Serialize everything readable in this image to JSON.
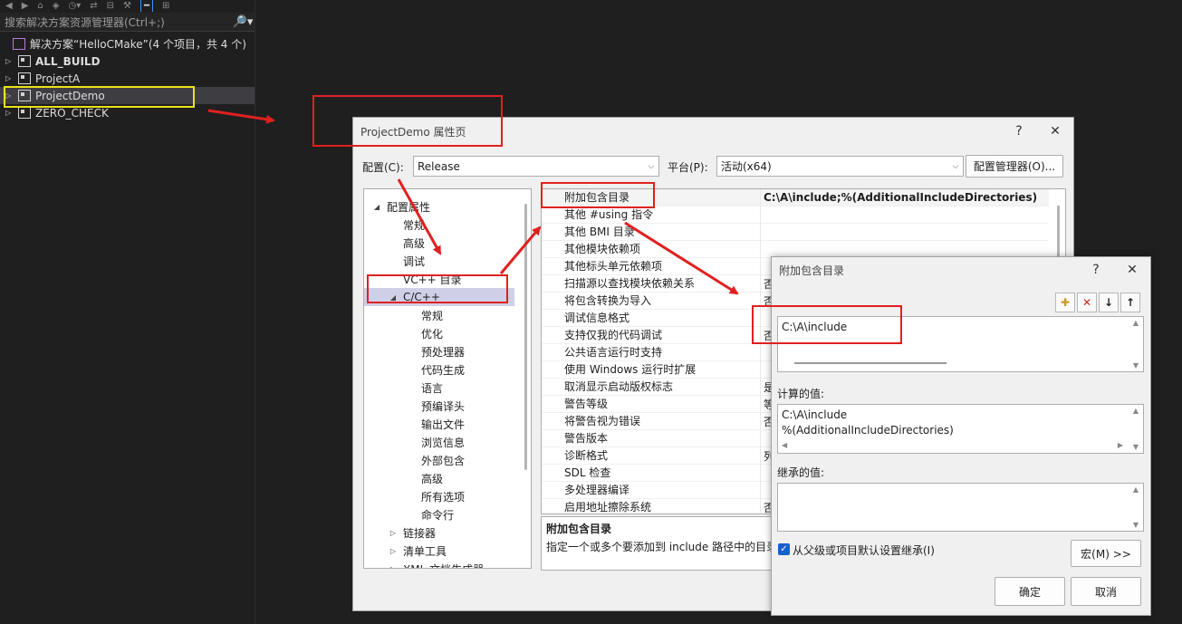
{
  "explorer": {
    "toolbar_icons": [
      "back-icon",
      "forward-icon",
      "home-icon",
      "vs-icon",
      "history-icon",
      "sync-icon",
      "collapse-icon",
      "wrench-icon",
      "active-view-icon",
      "graph-icon"
    ],
    "search_placeholder": "搜索解决方案资源管理器(Ctrl+;)",
    "search_icon": "🔎▾",
    "solution_label": "解决方案“HelloCMake”(4 个项目，共 4 个)",
    "projects": [
      {
        "name": "ALL_BUILD",
        "bold": true
      },
      {
        "name": "ProjectA",
        "bold": false
      },
      {
        "name": "ProjectDemo",
        "bold": false,
        "selected": true
      },
      {
        "name": "ZERO_CHECK",
        "bold": false
      }
    ]
  },
  "property_dialog": {
    "title": "ProjectDemo 属性页",
    "help": "?",
    "close": "✕",
    "config_label": "配置(C):",
    "config_value": "Release",
    "platform_label": "平台(P):",
    "platform_value": "活动(x64)",
    "config_manager": "配置管理器(O)...",
    "nav": [
      {
        "label": "配置属性",
        "level": 0,
        "tri": "◢"
      },
      {
        "label": "常规",
        "level": 1
      },
      {
        "label": "高级",
        "level": 1
      },
      {
        "label": "调试",
        "level": 1
      },
      {
        "label": "VC++ 目录",
        "level": 1
      },
      {
        "label": "C/C++",
        "level": 1,
        "tri": "◢",
        "selected": true
      },
      {
        "label": "常规",
        "level": 2
      },
      {
        "label": "优化",
        "level": 2
      },
      {
        "label": "预处理器",
        "level": 2
      },
      {
        "label": "代码生成",
        "level": 2
      },
      {
        "label": "语言",
        "level": 2
      },
      {
        "label": "预编译头",
        "level": 2
      },
      {
        "label": "输出文件",
        "level": 2
      },
      {
        "label": "浏览信息",
        "level": 2
      },
      {
        "label": "外部包含",
        "level": 2
      },
      {
        "label": "高级",
        "level": 2
      },
      {
        "label": "所有选项",
        "level": 2
      },
      {
        "label": "命令行",
        "level": 2
      },
      {
        "label": "链接器",
        "level": 1,
        "tri": "▷"
      },
      {
        "label": "清单工具",
        "level": 1,
        "tri": "▷"
      },
      {
        "label": "XML 文档生成器",
        "level": 1,
        "tri": "▷"
      }
    ],
    "grid": [
      {
        "name": "附加包含目录",
        "value": "C:\\A\\include;%(AdditionalIncludeDirectories)"
      },
      {
        "name": "其他 #using 指令",
        "value": ""
      },
      {
        "name": "其他 BMI 目录",
        "value": ""
      },
      {
        "name": "其他模块依赖项",
        "value": ""
      },
      {
        "name": "其他标头单元依赖项",
        "value": ""
      },
      {
        "name": "扫描源以查找模块依赖关系",
        "value": "否"
      },
      {
        "name": "将包含转换为导入",
        "value": "否"
      },
      {
        "name": "调试信息格式",
        "value": ""
      },
      {
        "name": "支持仅我的代码调试",
        "value": "否"
      },
      {
        "name": "公共语言运行时支持",
        "value": ""
      },
      {
        "name": "使用 Windows 运行时扩展",
        "value": ""
      },
      {
        "name": "取消显示启动版权标志",
        "value": "是"
      },
      {
        "name": "警告等级",
        "value": "等"
      },
      {
        "name": "将警告视为错误",
        "value": "否"
      },
      {
        "name": "警告版本",
        "value": ""
      },
      {
        "name": "诊断格式",
        "value": "列"
      },
      {
        "name": "SDL 检查",
        "value": ""
      },
      {
        "name": "多处理器编译",
        "value": ""
      },
      {
        "name": "启用地址擦除系统",
        "value": "否"
      }
    ],
    "desc_title": "附加包含目录",
    "desc_text": "指定一个或多个要添加到 include 路径中的目录"
  },
  "include_dialog": {
    "title": "附加包含目录",
    "help": "?",
    "close": "✕",
    "tools": [
      {
        "icon": "new-folder-icon",
        "glyph": "✚"
      },
      {
        "icon": "delete-icon",
        "glyph": "✕"
      },
      {
        "icon": "move-down-icon",
        "glyph": "↓"
      },
      {
        "icon": "move-up-icon",
        "glyph": "↑"
      }
    ],
    "entries": [
      "C:\\A\\include"
    ],
    "computed_label": "计算的值:",
    "computed_values": [
      "C:\\A\\include",
      "%(AdditionalIncludeDirectories)"
    ],
    "inherited_label": "继承的值:",
    "inherit_checkbox": "从父级或项目默认设置继承(I)",
    "macro_button": "宏(M) >>",
    "ok": "确定",
    "cancel": "取消"
  }
}
